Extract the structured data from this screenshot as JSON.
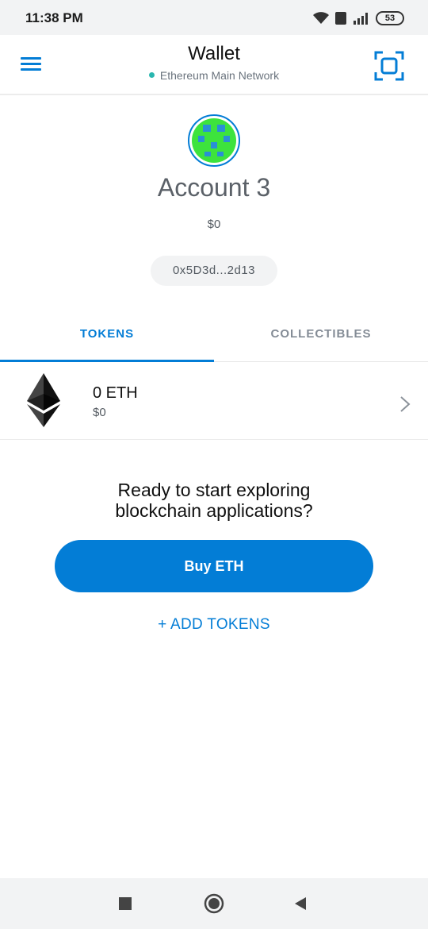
{
  "status_bar": {
    "time": "11:38 PM",
    "battery": "53",
    "icons": [
      "wifi-icon",
      "volte-icon",
      "signal-icon",
      "battery-icon"
    ]
  },
  "header": {
    "title": "Wallet",
    "network": "Ethereum Main Network",
    "menu_icon": "hamburger-menu-icon",
    "scan_icon": "qr-scan-icon"
  },
  "account": {
    "name": "Account 3",
    "balance": "$0",
    "address": "0x5D3d...2d13"
  },
  "tabs": [
    {
      "label": "TOKENS",
      "active": true
    },
    {
      "label": "COLLECTIBLES",
      "active": false
    }
  ],
  "tokens": [
    {
      "amount": "0 ETH",
      "fiat": "$0",
      "icon": "ethereum-logo-icon"
    }
  ],
  "empty_state": {
    "message_line1": "Ready to start exploring",
    "message_line2": "blockchain applications?",
    "buy_label": "Buy ETH",
    "add_tokens_label": "+ ADD TOKENS"
  },
  "colors": {
    "accent": "#037dd6",
    "network_dot": "#29b6af",
    "avatar_green": "#3de33d"
  }
}
